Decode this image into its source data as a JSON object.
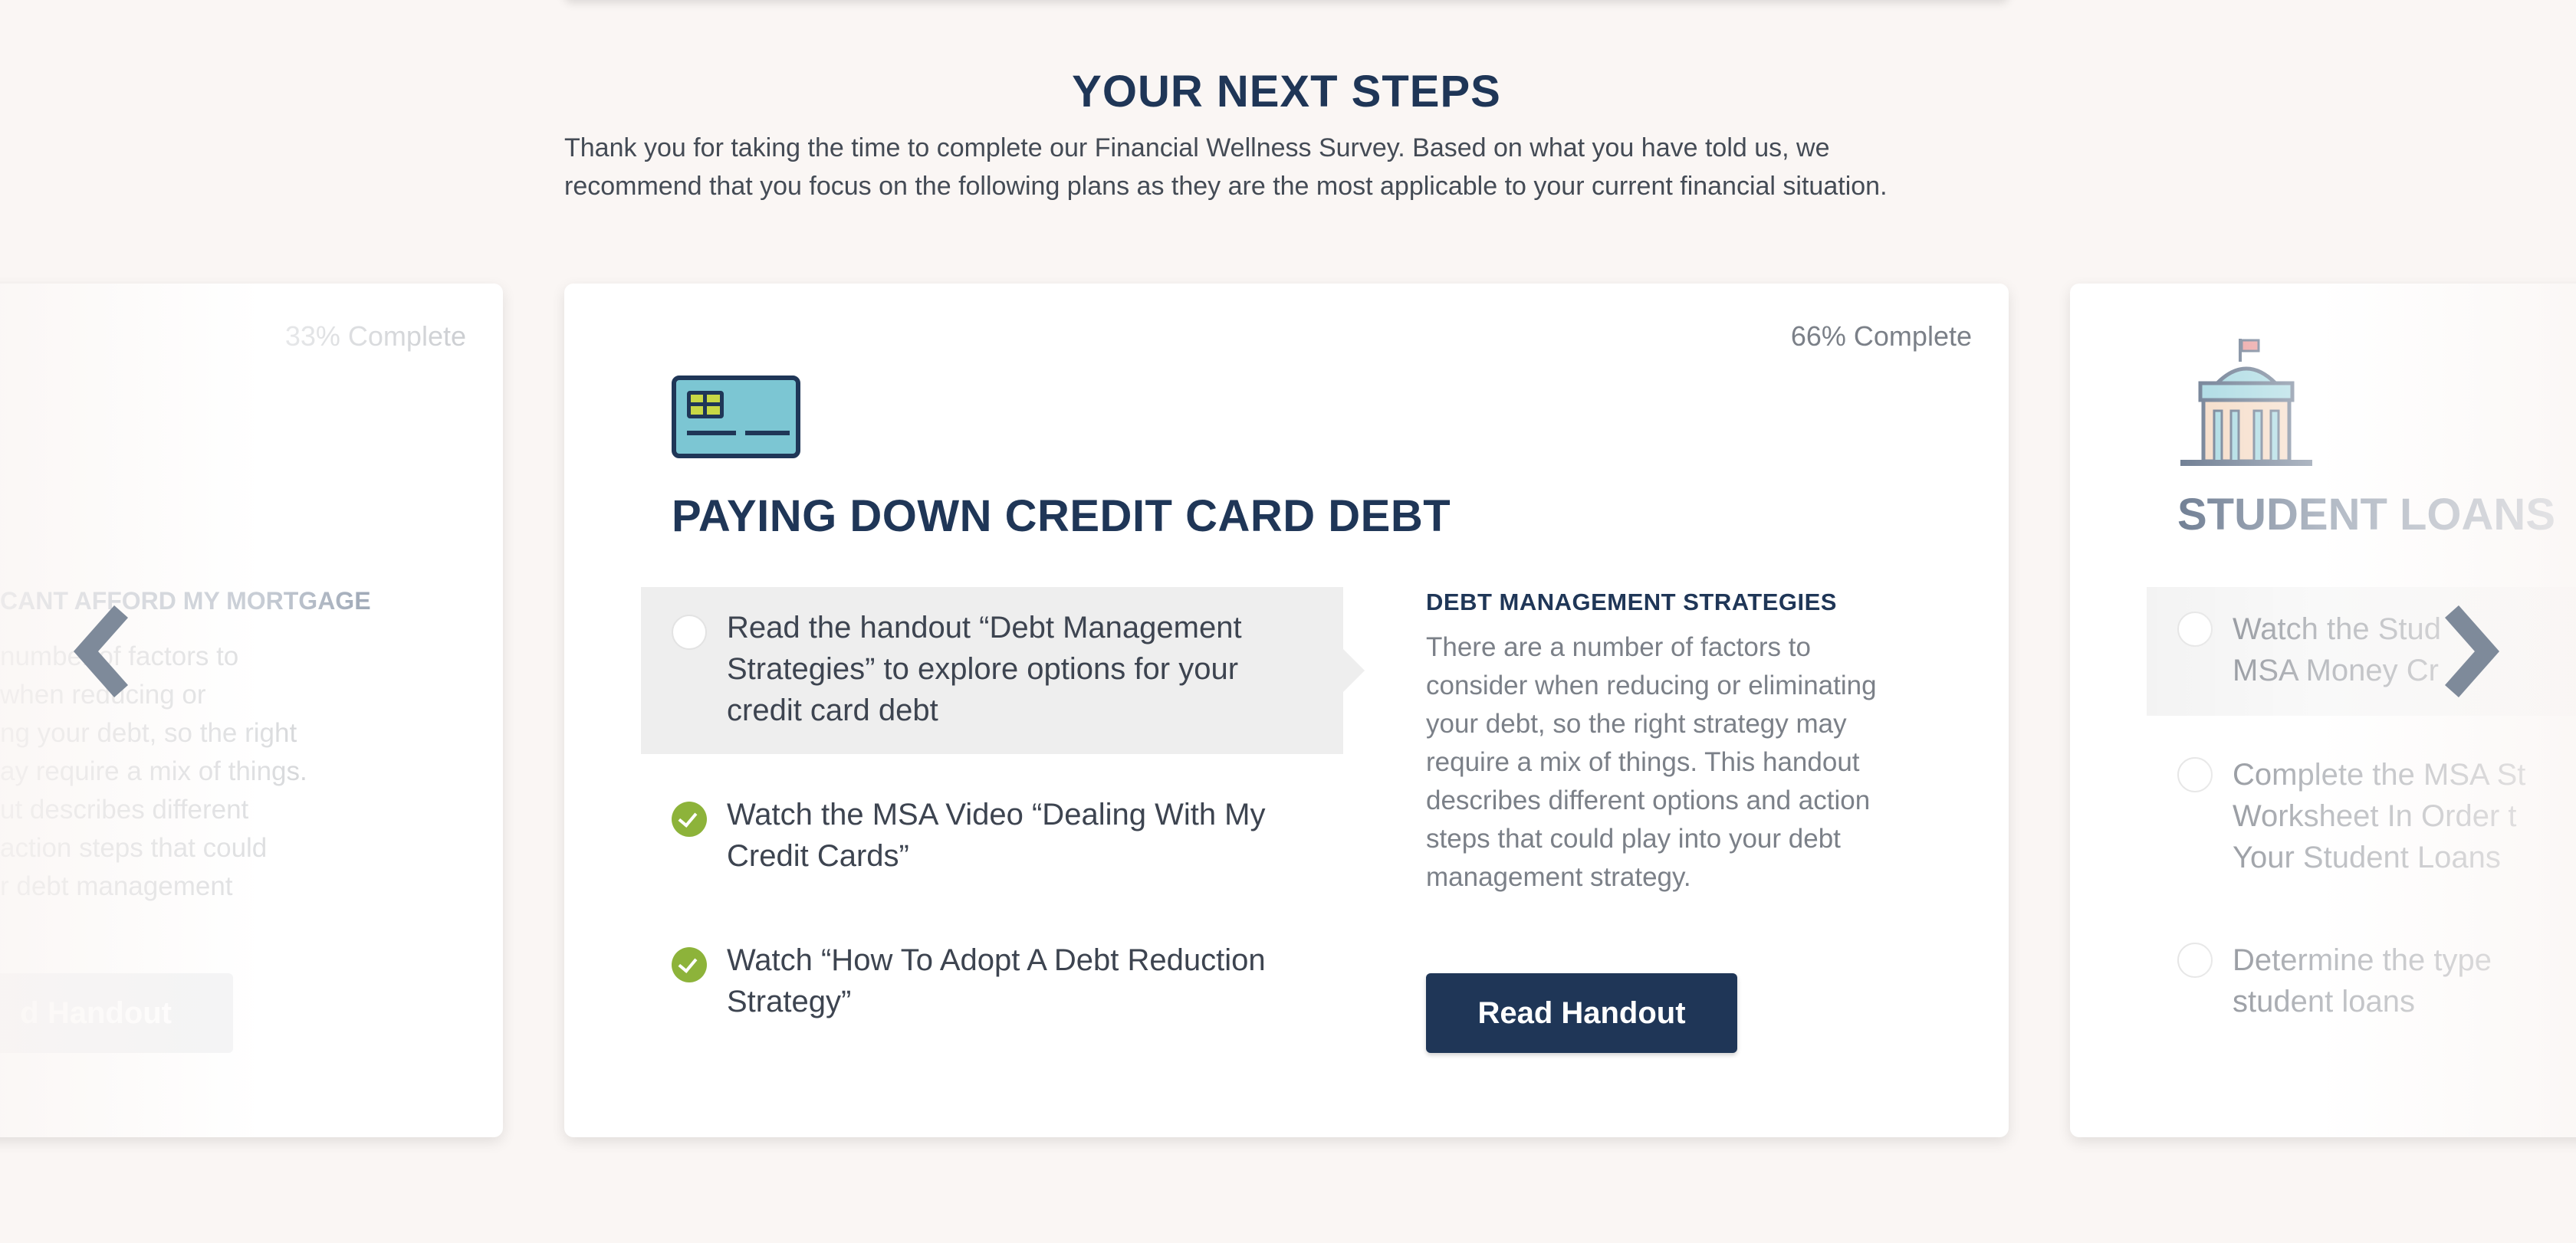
{
  "header": {
    "title": "YOUR NEXT STEPS",
    "intro_line1": "Thank you for taking the time to complete our Financial Wellness Survey. Based on what you have told us, we",
    "intro_line2": "recommend that you focus on the following plans as they are the most applicable to your current financial situation."
  },
  "left_card": {
    "progress": "33% Complete",
    "detail_title": "CANT AFFORD MY MORTGAGE",
    "detail_lines": [
      "number of factors to",
      "when reducing or",
      "ng your debt, so the right",
      "ay require a mix of things.",
      "ut describes different",
      "action steps that could",
      "r debt management"
    ],
    "button_label": "d Handout"
  },
  "main_card": {
    "progress": "66% Complete",
    "icon": "credit-card-icon",
    "title": "PAYING DOWN CREDIT CARD DEBT",
    "steps": [
      {
        "text": "Read the handout “Debt Management Strategies” to explore options for your credit card debt",
        "done": false,
        "active": true
      },
      {
        "text": "Watch the MSA Video “Dealing With My Credit Cards”",
        "done": true,
        "active": false
      },
      {
        "text": "Watch “How To Adopt A Debt Reduction Strategy”",
        "done": true,
        "active": false
      }
    ],
    "detail": {
      "title": "DEBT MANAGEMENT STRATEGIES",
      "body": "There are a number of factors to consider when reducing or eliminating your debt, so the right strategy may require a mix of things. This handout describes different options and action steps that could play into your debt management strategy.",
      "button_label": "Read Handout"
    }
  },
  "right_card": {
    "icon": "bank-building-icon",
    "title": "STUDENT LOANS",
    "steps": [
      {
        "line1": "Watch the Stud",
        "line2": "MSA Money Cr"
      },
      {
        "line1": "Complete the MSA St",
        "line2": "Worksheet In Order t",
        "line3": "Your Student Loans"
      },
      {
        "line1": "Determine the type",
        "line2": "student loans"
      }
    ]
  },
  "nav": {
    "prev_icon": "chevron-left-icon",
    "next_icon": "chevron-right-icon"
  },
  "colors": {
    "navy": "#1f3657",
    "check_green": "#8db33a",
    "card_teal": "#7cc6d3",
    "chip_yellow": "#c8d845",
    "background": "#faf6f4"
  }
}
